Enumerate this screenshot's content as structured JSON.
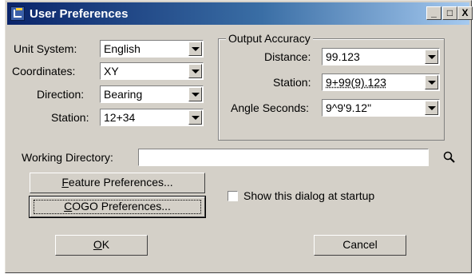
{
  "window": {
    "title": "User Preferences",
    "controls": {
      "minimize": "_",
      "maximize": "□",
      "close": "X"
    }
  },
  "left_fields": [
    {
      "label": "Unit System:",
      "value": "English"
    },
    {
      "label": "Coordinates:",
      "value": "XY"
    },
    {
      "label": "Direction:",
      "value": "Bearing"
    },
    {
      "label": "Station:",
      "value": "12+34"
    }
  ],
  "output_accuracy": {
    "title": "Output Accuracy",
    "fields": [
      {
        "label": "Distance:",
        "value": "99.123"
      },
      {
        "label": "Station:",
        "value": "9+99(9).123"
      },
      {
        "label": "Angle Seconds:",
        "value": "9^9'9.12\""
      }
    ]
  },
  "working_directory": {
    "label": "Working Directory:",
    "value": "",
    "icon": "search-icon"
  },
  "buttons": {
    "feature_mnemonic": "F",
    "feature_rest": "eature Preferences...",
    "cogo_mnemonic": "C",
    "cogo_rest": "OGO Preferences...",
    "ok_mnemonic": "O",
    "ok_rest": "K",
    "cancel": "Cancel"
  },
  "startup_checkbox": {
    "label": "Show this dialog at startup",
    "checked": false
  }
}
